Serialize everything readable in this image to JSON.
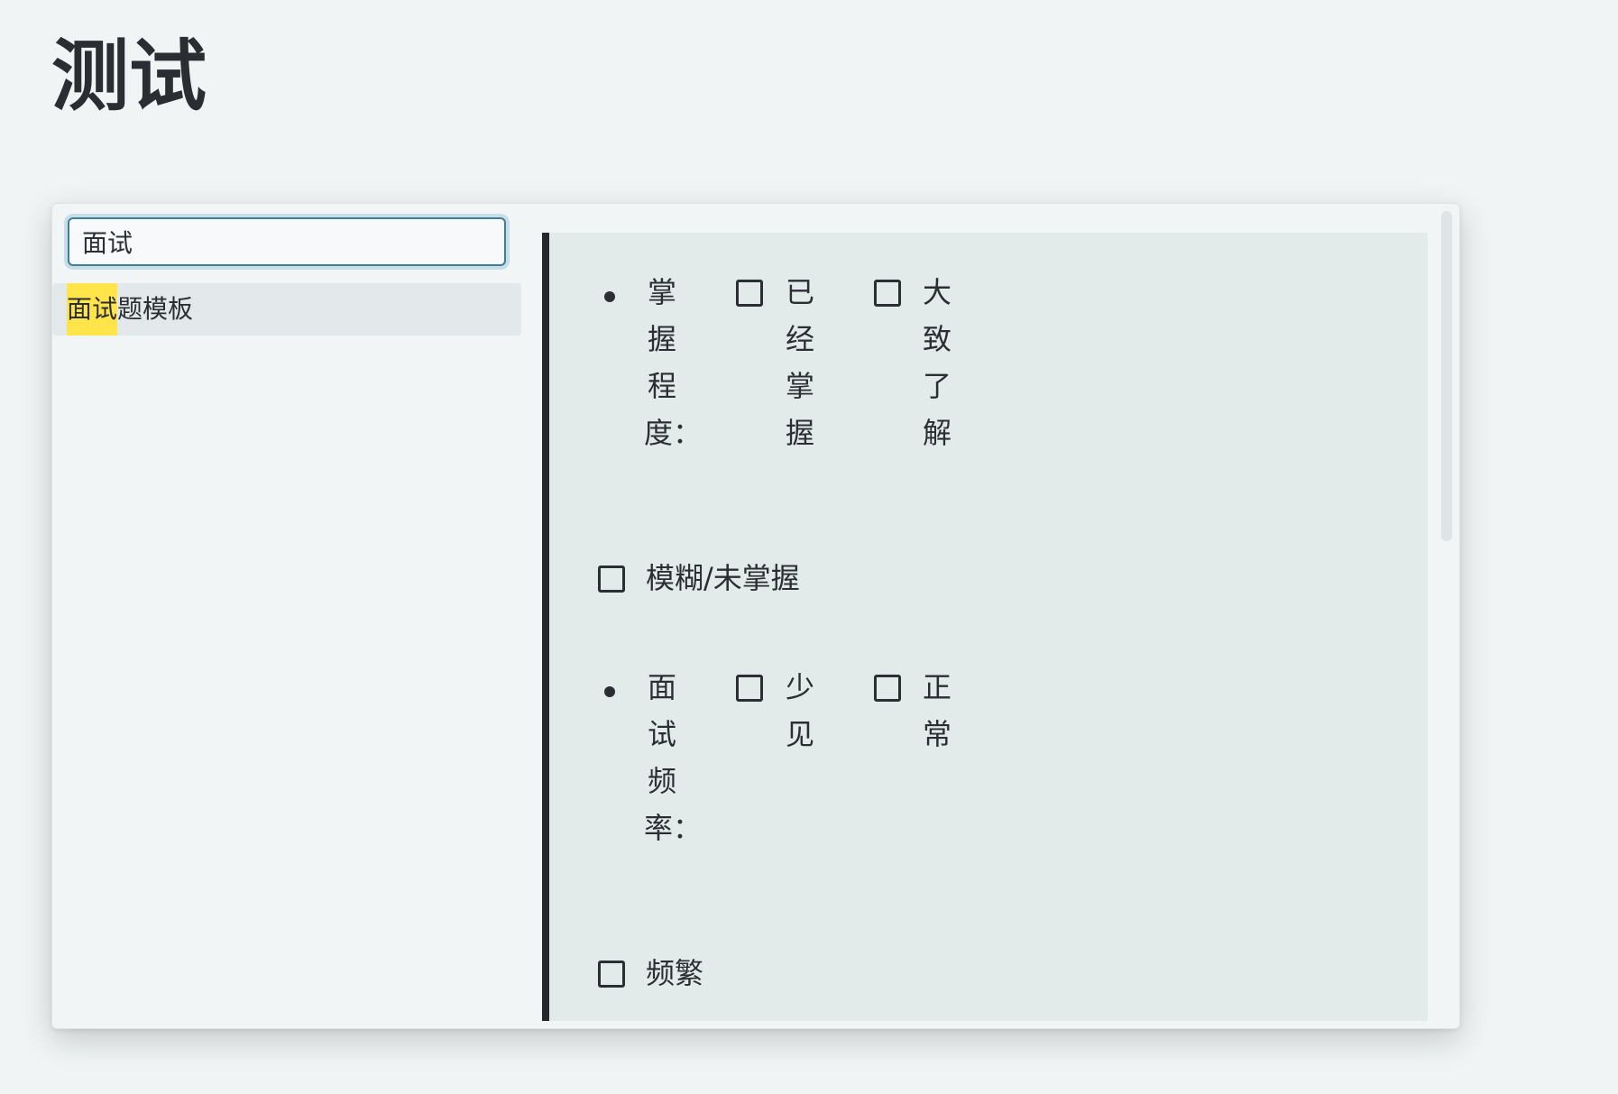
{
  "page": {
    "title": "测试"
  },
  "search": {
    "value": "面试"
  },
  "results": [
    {
      "highlight": "面试",
      "rest": "题模板"
    }
  ],
  "preview": {
    "mastery": {
      "label": "掌握程度：",
      "options": [
        "已经掌握",
        "大致了解",
        "模糊/未掌握"
      ]
    },
    "frequency": {
      "label": "面试频率：",
      "options": [
        "少见",
        "正常",
        "频繁"
      ]
    }
  }
}
